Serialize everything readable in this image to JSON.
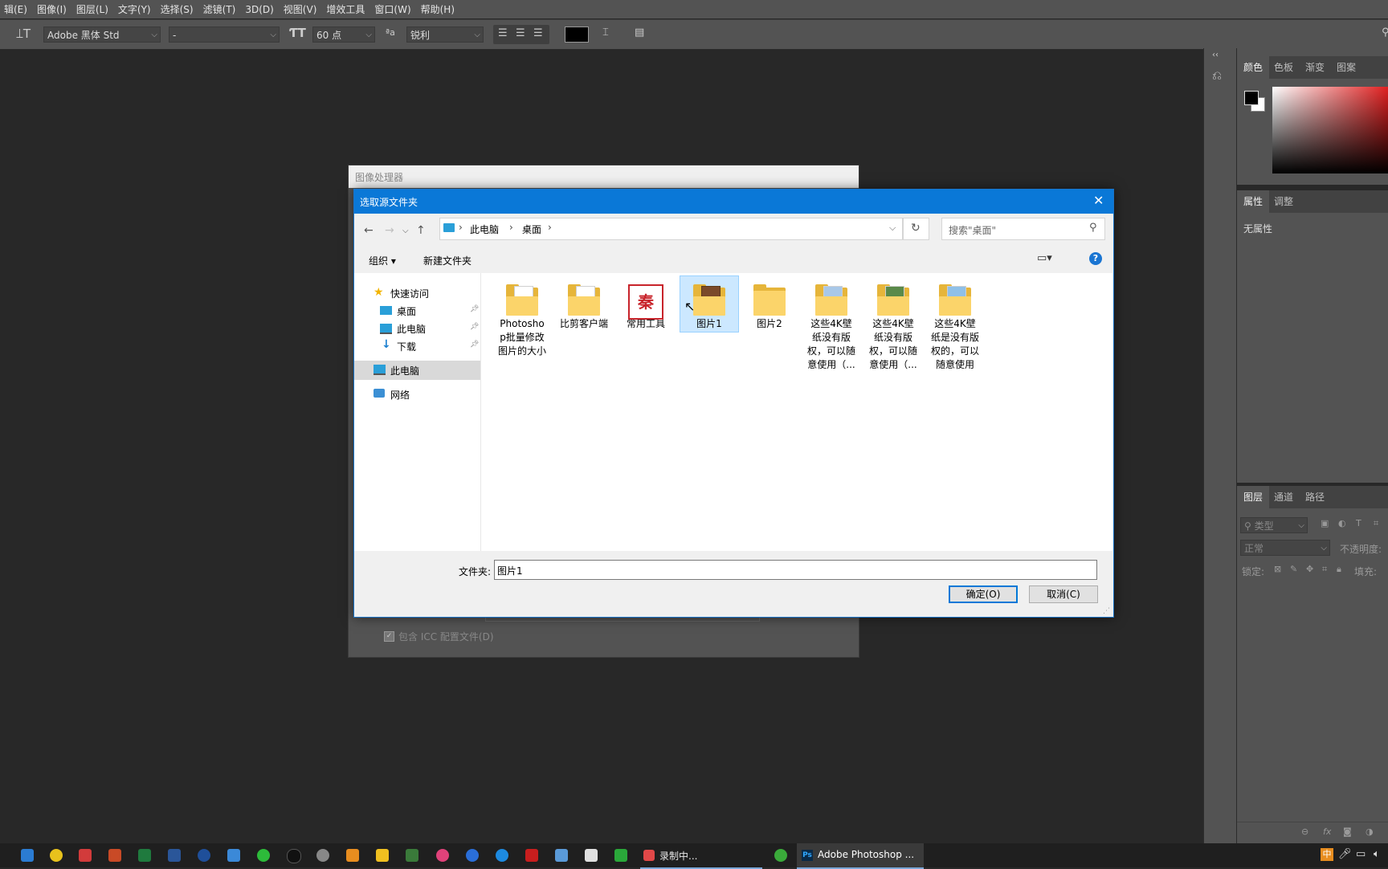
{
  "menu": [
    "辑(E)",
    "图像(I)",
    "图层(L)",
    "文字(Y)",
    "选择(S)",
    "滤镜(T)",
    "3D(D)",
    "视图(V)",
    "增效工具",
    "窗口(W)",
    "帮助(H)"
  ],
  "options_bar": {
    "font_family": "Adobe 黑体 Std",
    "font_style": "-",
    "font_size": "60 点",
    "aa_label": "ªa",
    "antialias": "锐利",
    "text_color": "#000000"
  },
  "right_panels": {
    "color_tabs": [
      "颜色",
      "色板",
      "渐变",
      "图案"
    ],
    "props_tabs": [
      "属性",
      "调整"
    ],
    "props_empty": "无属性",
    "layers_tabs": [
      "图层",
      "通道",
      "路径"
    ],
    "layers_filter_placeholder": "类型",
    "blend_mode": "正常",
    "opacity_label": "不透明度:",
    "lock_label": "锁定:",
    "fill_label": "填充:"
  },
  "ps_dialog": {
    "title": "图像处理器",
    "icc_label": "包含 ICC 配置文件(D)"
  },
  "file_dialog": {
    "title": "选取源文件夹",
    "breadcrumb": [
      "此电脑",
      "桌面"
    ],
    "search_placeholder": "搜索\"桌面\"",
    "organize": "组织 ▾",
    "new_folder": "新建文件夹",
    "nav": {
      "quick_access": "快速访问",
      "desktop": "桌面",
      "this_pc_pinned": "此电脑",
      "downloads": "下载",
      "this_pc": "此电脑",
      "network": "网络"
    },
    "files": [
      {
        "name": "Photoshop批量修改图片的大小",
        "lines": [
          "Photosho",
          "p批量修改",
          "图片的大小"
        ]
      },
      {
        "name": "比剪客户端",
        "lines": [
          "比剪客户端"
        ]
      },
      {
        "name": "常用工具",
        "lines": [
          "常用工具"
        ]
      },
      {
        "name": "图片1",
        "lines": [
          "图片1"
        ]
      },
      {
        "name": "图片2",
        "lines": [
          "图片2"
        ]
      },
      {
        "name": "这些4K壁纸没有版权，可以随意使用（...",
        "lines": [
          "这些4K壁",
          "纸没有版",
          "权，可以随",
          "意使用（..."
        ]
      },
      {
        "name": "这些4K壁纸没有版权，可以随意使用（...",
        "lines": [
          "这些4K壁",
          "纸没有版",
          "权，可以随",
          "意使用（..."
        ]
      },
      {
        "name": "这些4K壁纸是没有版权的，可以随意使用",
        "lines": [
          "这些4K壁",
          "纸是没有版",
          "权的，可以",
          "随意使用"
        ]
      }
    ],
    "selected_index": 3,
    "folder_label": "文件夹:",
    "folder_value": "图片1",
    "ok_button": "确定(O)",
    "cancel_button": "取消(C)"
  },
  "taskbar": {
    "recording": "录制中...",
    "photoshop": "Adobe Photoshop ...",
    "ime": "中"
  }
}
